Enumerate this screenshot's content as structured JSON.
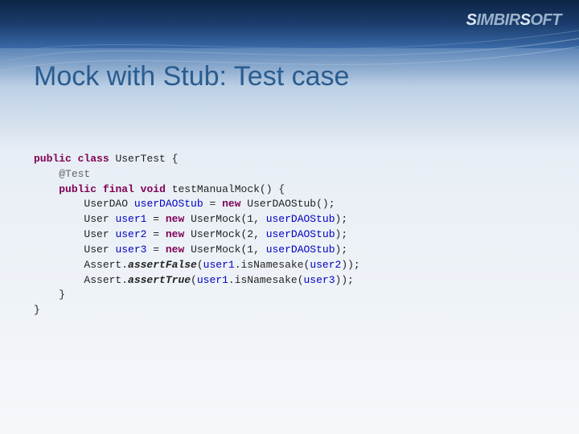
{
  "brand": {
    "s1": "S",
    "part1": "IMBIR",
    "s2": "S",
    "part2": "OFT"
  },
  "title": "Mock with Stub: Test case",
  "code": {
    "l1": {
      "k1": "public",
      "k2": "class",
      "name": "UserTest {"
    },
    "l2": {
      "indent": "    ",
      "ann": "@Test"
    },
    "l3": {
      "indent": "    ",
      "k1": "public",
      "k2": "final",
      "k3": "void",
      "name": "testManualMock() {"
    },
    "l4": {
      "indent": "        ",
      "t1": "UserDAO ",
      "f": "userDAOStub",
      "t2": " = ",
      "k": "new",
      "t3": " UserDAOStub();"
    },
    "l5": {
      "indent": "        ",
      "t1": "User ",
      "f": "user1",
      "t2": " = ",
      "k": "new",
      "t3": " UserMock(1, ",
      "arg": "userDAOStub",
      "t4": ");"
    },
    "l6": {
      "indent": "        ",
      "t1": "User ",
      "f": "user2",
      "t2": " = ",
      "k": "new",
      "t3": " UserMock(2, ",
      "arg": "userDAOStub",
      "t4": ");"
    },
    "l7": {
      "indent": "        ",
      "t1": "User ",
      "f": "user3",
      "t2": " = ",
      "k": "new",
      "t3": " UserMock(1, ",
      "arg": "userDAOStub",
      "t4": ");"
    },
    "l8": {
      "indent": "        ",
      "t1": "Assert.",
      "m": "assertFalse",
      "t2": "(",
      "a1": "user1",
      "t3": ".isNamesake(",
      "a2": "user2",
      "t4": "));"
    },
    "l9": {
      "indent": "        ",
      "t1": "Assert.",
      "m": "assertTrue",
      "t2": "(",
      "a1": "user1",
      "t3": ".isNamesake(",
      "a2": "user3",
      "t4": "));"
    },
    "l10": {
      "indent": "    ",
      "t": "}"
    },
    "l11": {
      "t": "}"
    }
  }
}
